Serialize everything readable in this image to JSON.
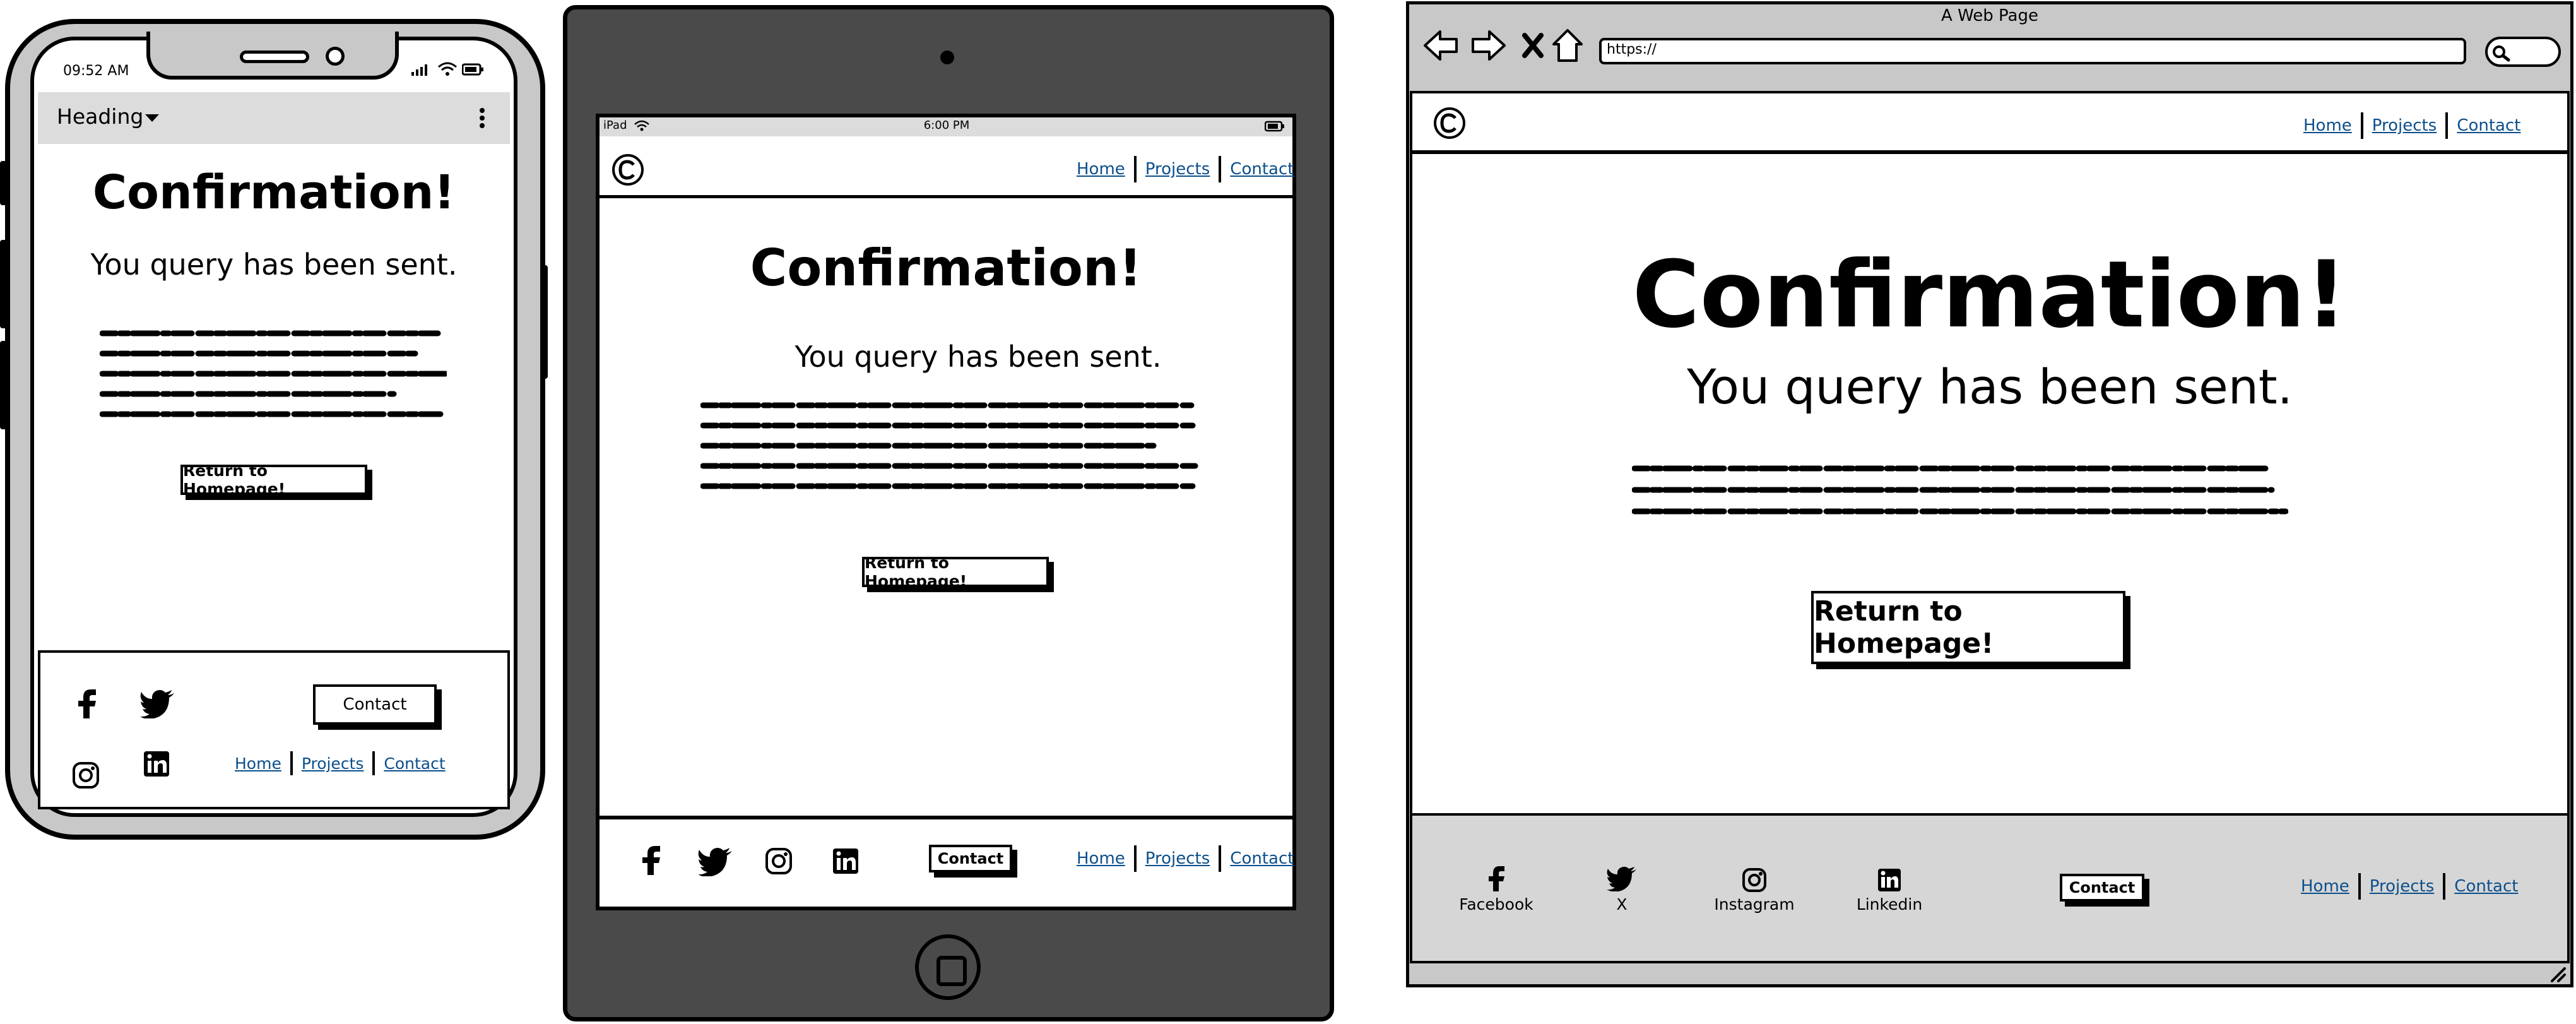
{
  "phone": {
    "status_time": "09:52 AM",
    "appbar_heading": "Heading",
    "title": "Confirmation!",
    "subtitle": "You query has been sent.",
    "button": "Return to Homepage!",
    "footer_contact": "Contact",
    "nav": [
      "Home",
      "Projects",
      "Contact"
    ]
  },
  "tablet": {
    "status_left": "iPad",
    "status_time": "6:00 PM",
    "nav": [
      "Home",
      "Projects",
      "Contact"
    ],
    "title": "Confirmation!",
    "subtitle": "You query has been sent.",
    "button": "Return to Homepage!",
    "footer_contact": "Contact"
  },
  "browser": {
    "window_title": "A Web Page",
    "url": "https://",
    "nav": [
      "Home",
      "Projects",
      "Contact"
    ],
    "title": "Confirmation!",
    "subtitle": "You query has been sent.",
    "button": "Return to Homepage!",
    "footer_contact": "Contact",
    "social": [
      {
        "label": "Facebook",
        "icon": "facebook-icon"
      },
      {
        "label": "X",
        "icon": "twitter-icon"
      },
      {
        "label": "Instagram",
        "icon": "instagram-icon"
      },
      {
        "label": "Linkedin",
        "icon": "linkedin-icon"
      }
    ]
  },
  "colors": {
    "device_dark": "#4a4a4a",
    "device_light": "#c8c8c8",
    "footer_gray": "#d6d6d6",
    "link_blue": "#0b4f8c"
  }
}
